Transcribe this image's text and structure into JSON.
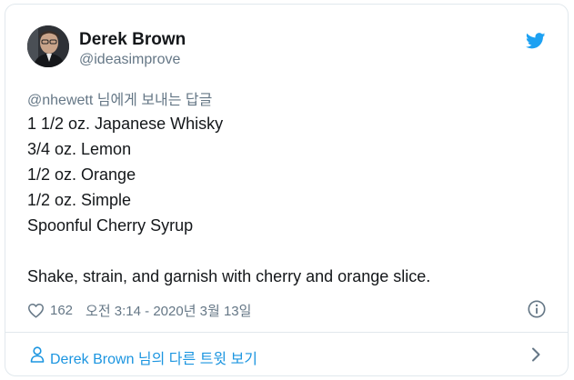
{
  "tweet": {
    "author_name": "Derek Brown",
    "author_handle": "@ideasimprove",
    "reply_to": "@nhewett 님에게 보내는 답글",
    "lines": [
      "1 1/2 oz. Japanese Whisky",
      "3/4 oz. Lemon",
      "1/2 oz. Orange",
      "1/2 oz. Simple",
      "Spoonful Cherry Syrup"
    ],
    "closing": "Shake, strain, and garnish with cherry and orange slice.",
    "likes": "162",
    "timestamp": "오전 3:14 - 2020년 3월 13일"
  },
  "footer": {
    "more_link": "Derek Brown 님의 다른 트윗 보기"
  },
  "icons": {
    "brand": "twitter-bird-icon",
    "like": "heart-icon",
    "info": "info-icon",
    "profile": "person-icon",
    "next": "chevron-right-icon"
  },
  "colors": {
    "twitter_blue": "#1da1f2",
    "link_blue": "#1b95e0",
    "secondary_text": "#657786",
    "border": "#e1e8ed",
    "primary_text": "#14171a"
  }
}
